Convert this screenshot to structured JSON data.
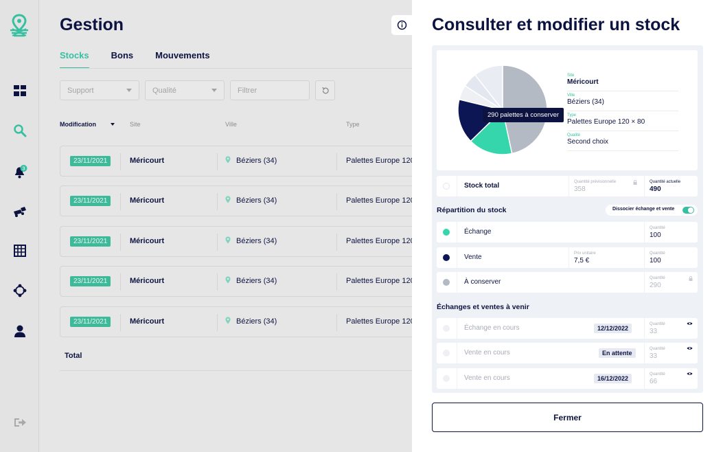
{
  "main": {
    "title": "Gestion",
    "tabs": [
      {
        "label": "Stocks",
        "active": true
      },
      {
        "label": "Bons",
        "active": false
      },
      {
        "label": "Mouvements",
        "active": false
      }
    ],
    "filters": {
      "support": "Support",
      "qualite": "Qualité",
      "search_placeholder": "Filtrer"
    },
    "table": {
      "headers": [
        "Modification",
        "Site",
        "Ville",
        "Type"
      ],
      "rows": [
        {
          "date": "23/11/2021",
          "site": "Méricourt",
          "ville": "Béziers (34)",
          "type": "Palettes Europe 120"
        },
        {
          "date": "23/11/2021",
          "site": "Méricourt",
          "ville": "Béziers (34)",
          "type": "Palettes Europe 120"
        },
        {
          "date": "23/11/2021",
          "site": "Méricourt",
          "ville": "Béziers (34)",
          "type": "Palettes Europe 120"
        },
        {
          "date": "23/11/2021",
          "site": "Méricourt",
          "ville": "Béziers (34)",
          "type": "Palettes Europe 120"
        },
        {
          "date": "23/11/2021",
          "site": "Méricourt",
          "ville": "Béziers (34)",
          "type": "Palettes Europe 120"
        }
      ],
      "total_label": "Total"
    }
  },
  "sidebar": {
    "notification_count": "3",
    "brand_color": "#36c0a1"
  },
  "drawer": {
    "title": "Consulter et modifier un stock",
    "info": {
      "site_label": "Site",
      "site": "Méricourt",
      "ville_label": "Ville",
      "ville": "Béziers (34)",
      "type_label": "Type",
      "type": "Palettes Europe 120 × 80",
      "qualite_label": "Qualité",
      "qualite": "Second choix"
    },
    "tooltip": "290 palettes à conserver",
    "stock_total": {
      "label": "Stock total",
      "previsionnelle_label": "Quantité prévisionnelle",
      "previsionnelle": "358",
      "actuelle_label": "Quantité actuelle",
      "actuelle": "490"
    },
    "repartition": {
      "title": "Répartition du stock",
      "toggle_label": "Dissocier échange et vente",
      "toggle_on": true,
      "echange": {
        "label": "Échange",
        "qty_label": "Quantité",
        "qty": "100",
        "color": "#36d6ad"
      },
      "vente": {
        "label": "Vente",
        "price_label": "Prix unitaire",
        "price": "7,5 €",
        "qty_label": "Quantité",
        "qty": "100",
        "color": "#0d1654"
      },
      "conserver": {
        "label": "À conserver",
        "qty_label": "Quantité",
        "qty": "290",
        "color": "#b4bac4"
      }
    },
    "avenir": {
      "title": "Échanges et ventes à venir",
      "items": [
        {
          "label": "Échange en cours",
          "badge": "12/12/2022",
          "qty_label": "Quantité",
          "qty": "33"
        },
        {
          "label": "Vente en cours",
          "badge": "En attente",
          "qty_label": "Quantité",
          "qty": "33"
        },
        {
          "label": "Vente en cours",
          "badge": "16/12/2022",
          "qty_label": "Quantité",
          "qty": "66"
        }
      ]
    },
    "close_label": "Fermer"
  },
  "chart_data": {
    "type": "pie",
    "slices": [
      {
        "label": "À conserver",
        "value": 290,
        "color": "#b4bac4"
      },
      {
        "label": "Échange",
        "value": 100,
        "color": "#36d6ad"
      },
      {
        "label": "Vente",
        "value": 100,
        "color": "#0d1654"
      },
      {
        "label": "Échange en cours",
        "value": 33,
        "color": "#eef0f4"
      },
      {
        "label": "Vente en cours",
        "value": 33,
        "color": "#e3e7ef"
      },
      {
        "label": "Vente en cours",
        "value": 66,
        "color": "#e9ecf2"
      }
    ]
  }
}
